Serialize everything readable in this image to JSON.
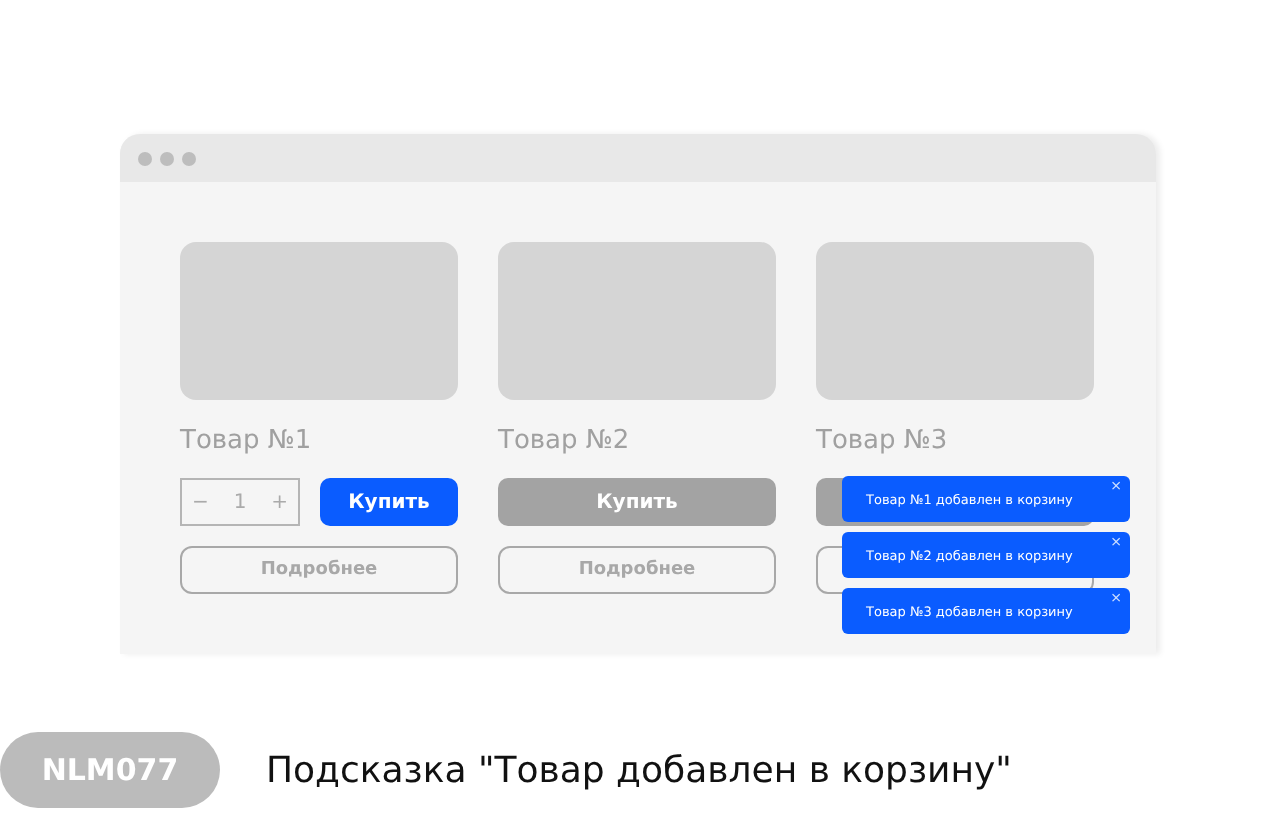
{
  "products": [
    {
      "name": "Товар №1",
      "stepper": {
        "minus": "−",
        "value": "1",
        "plus": "+"
      },
      "buy": {
        "label": "Купить",
        "disabled": false
      },
      "details": {
        "kind": "button",
        "label": "Подробнее"
      }
    },
    {
      "name": "Товар №2",
      "buy": {
        "label": "Купить",
        "disabled": true
      },
      "details": {
        "kind": "button",
        "label": "Подробнее"
      }
    },
    {
      "name": "Товар №3",
      "buy": {
        "disabled": true
      },
      "details": {
        "kind": "button"
      }
    }
  ],
  "toasts": [
    {
      "text": "Товар №1 добавлен в корзину",
      "close": "×"
    },
    {
      "text": "Товар №2 добавлен в корзину",
      "close": "×"
    },
    {
      "text": "Товар №3 добавлен в корзину",
      "close": "×"
    }
  ],
  "caption": {
    "code": "NLM077",
    "title": "Подсказка \"Товар добавлен в корзину\""
  }
}
